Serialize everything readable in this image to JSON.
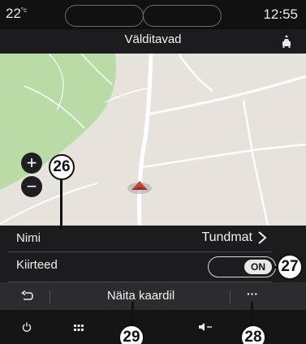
{
  "status": {
    "temperature": "22",
    "temperature_unit": "°c",
    "clock": "12:55"
  },
  "header": {
    "title": "Välditavad"
  },
  "map": {
    "zoom_in_label": "+",
    "zoom_out_label": "−",
    "colors": {
      "land": "#e6e2dc",
      "park": "#b9dca6",
      "road": "#ffffff",
      "position_marker": "#c2473f"
    }
  },
  "rows": {
    "name": {
      "label": "Nimi",
      "value": "Tundmat"
    },
    "routes": {
      "label": "Kiirteed",
      "toggle_state": "ON"
    }
  },
  "action_bar": {
    "center_label": "Näita kaardil",
    "more_label": "···"
  },
  "callouts": {
    "c26": "26",
    "c27": "27",
    "c28": "28",
    "c29": "29"
  }
}
